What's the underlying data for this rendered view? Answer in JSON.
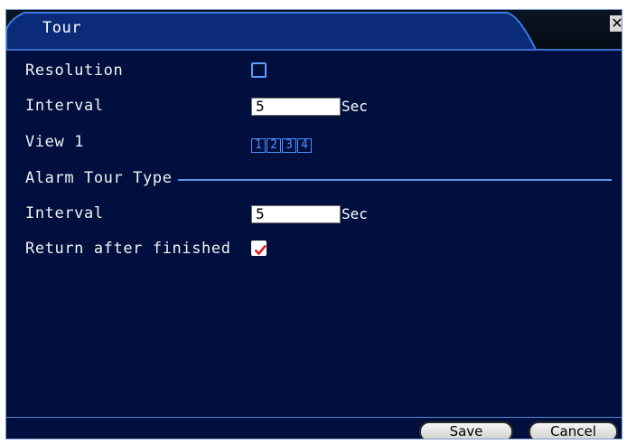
{
  "window": {
    "title": "Tour",
    "close_glyph": "✕"
  },
  "settings": {
    "resolution_label": "Resolution",
    "resolution_checked": false,
    "interval_label": "Interval",
    "interval_value": "5",
    "interval_unit": "Sec",
    "view_label": "View 1",
    "view_options": [
      "1",
      "2",
      "3",
      "4"
    ]
  },
  "alarm": {
    "section_label": "Alarm Tour Type",
    "interval_label": "Interval",
    "interval_value": "5",
    "interval_unit": "Sec",
    "return_label": "Return after finished",
    "return_checked": true
  },
  "footer": {
    "save_label": "Save",
    "cancel_label": "Cancel"
  },
  "colors": {
    "background": "#000f3d",
    "accent": "#3a6fd0",
    "checkbox_border": "#5e9cff",
    "check_mark": "#e02020"
  }
}
